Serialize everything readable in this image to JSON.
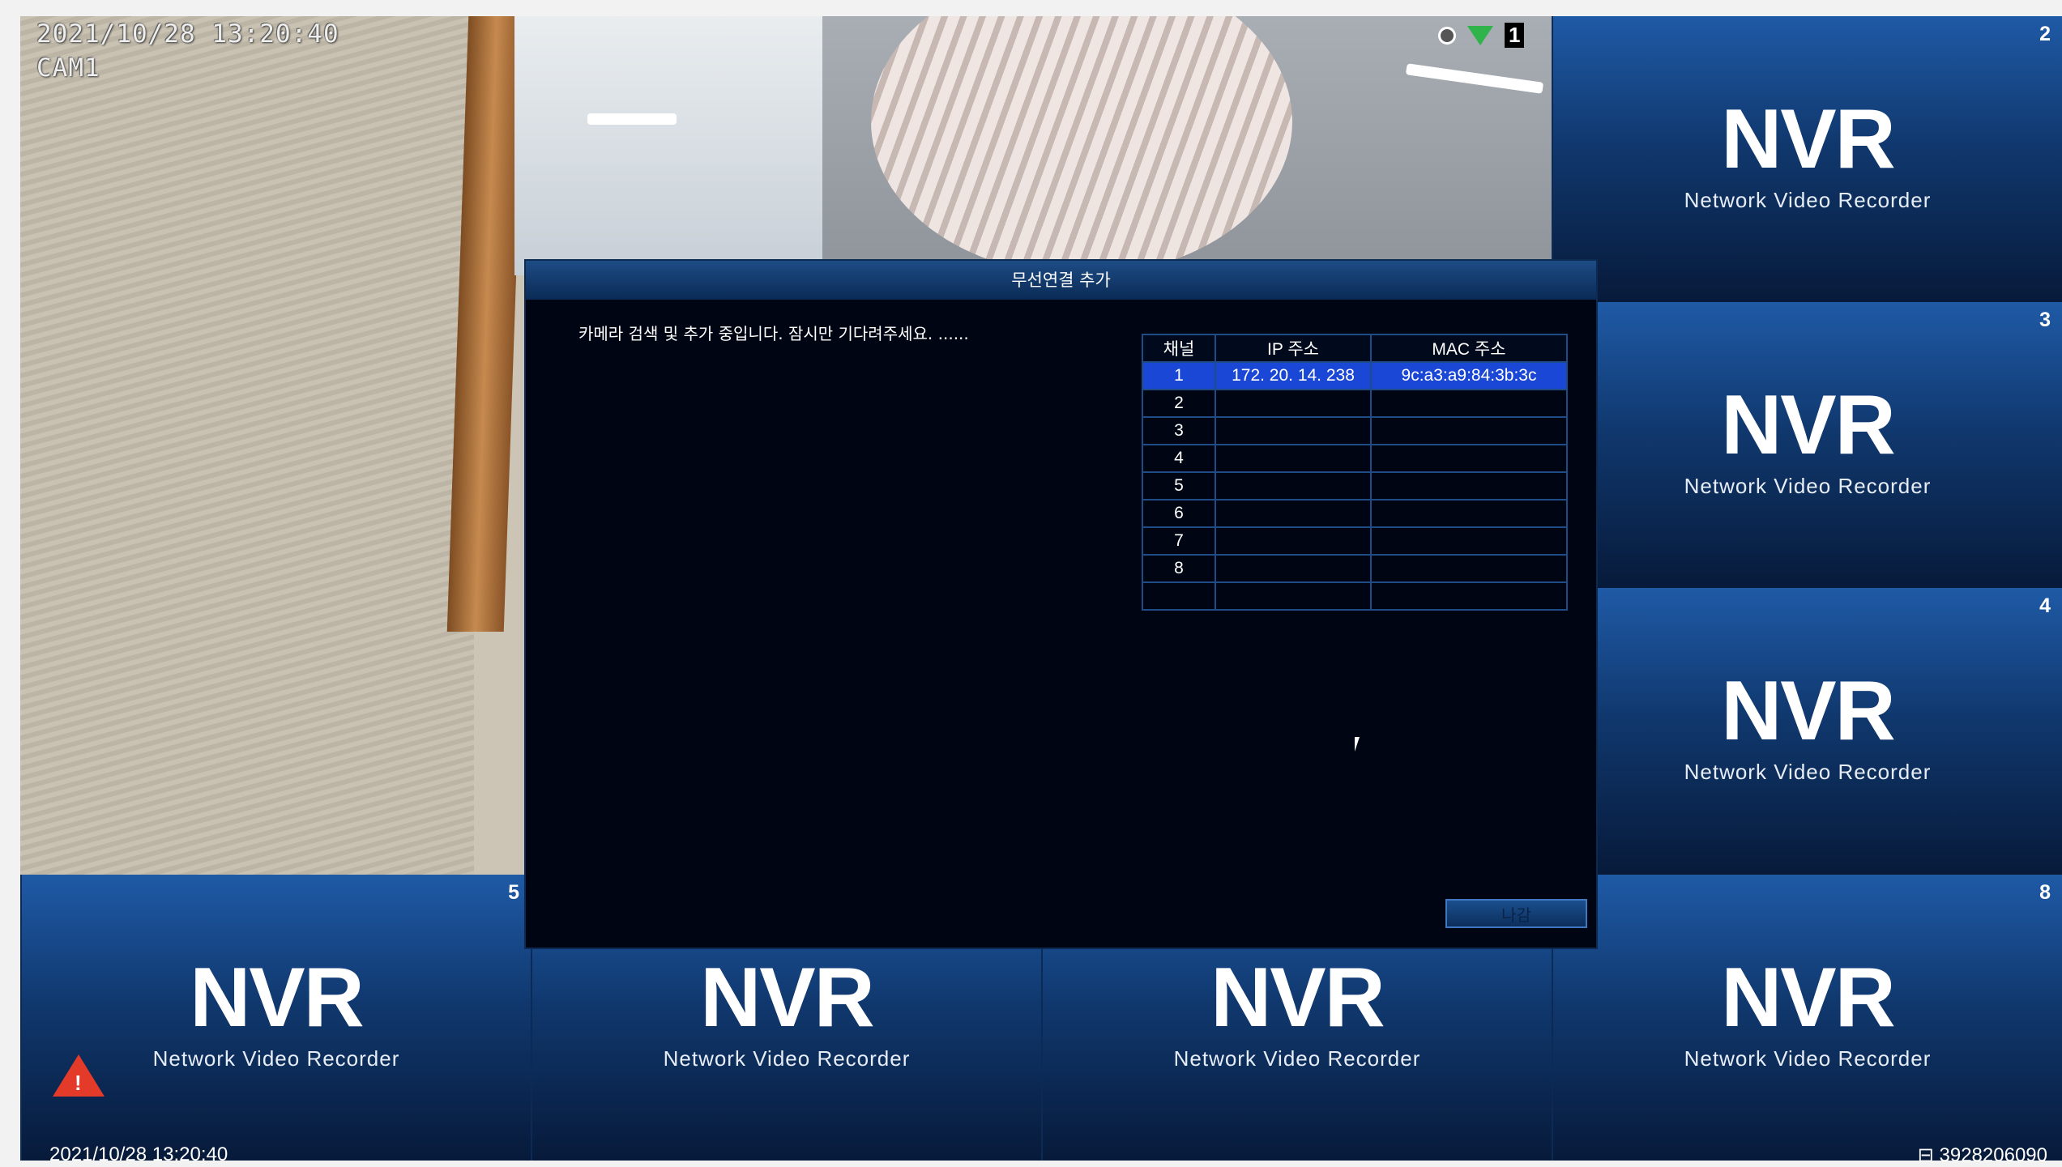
{
  "cam1": {
    "datetime": "2021/10/28 13:20:40",
    "label": "CAM1",
    "channel_badge": "1"
  },
  "tiles": [
    {
      "channel": "2",
      "logo": "NVR",
      "subtitle": "Network Video Recorder"
    },
    {
      "channel": "3",
      "logo": "NVR",
      "subtitle": "Network Video Recorder"
    },
    {
      "channel": "4",
      "logo": "NVR",
      "subtitle": "Network Video Recorder"
    },
    {
      "channel": "5",
      "logo": "NVR",
      "subtitle": "Network Video Recorder"
    },
    {
      "channel": "",
      "logo": "NVR",
      "subtitle": "Network Video Recorder"
    },
    {
      "channel": "",
      "logo": "NVR",
      "subtitle": "Network Video Recorder"
    },
    {
      "channel": "8",
      "logo": "NVR",
      "subtitle": "Network Video Recorder"
    }
  ],
  "dialog": {
    "title": "무선연결 추가",
    "message": "카메라 검색 및 추가 중입니다. 잠시만 기다려주세요. ......",
    "table": {
      "headers": [
        "채널",
        "IP 주소",
        "MAC 주소"
      ],
      "rows": [
        [
          "1",
          "172. 20. 14. 238",
          "9c:a3:a9:84:3b:3c"
        ],
        [
          "2",
          "",
          ""
        ],
        [
          "3",
          "",
          ""
        ],
        [
          "4",
          "",
          ""
        ],
        [
          "5",
          "",
          ""
        ],
        [
          "6",
          "",
          ""
        ],
        [
          "7",
          "",
          ""
        ],
        [
          "8",
          "",
          ""
        ],
        [
          "",
          "",
          ""
        ]
      ]
    },
    "exit_label": "나감"
  },
  "footer": {
    "datetime": "2021/10/28 13:20:40",
    "device_id": "3928206090"
  },
  "colors": {
    "selected_row": "#1b47d6",
    "tile_top": "#1f5aa6",
    "tile_bottom": "#071a3a",
    "warning": "#e43a2a"
  }
}
